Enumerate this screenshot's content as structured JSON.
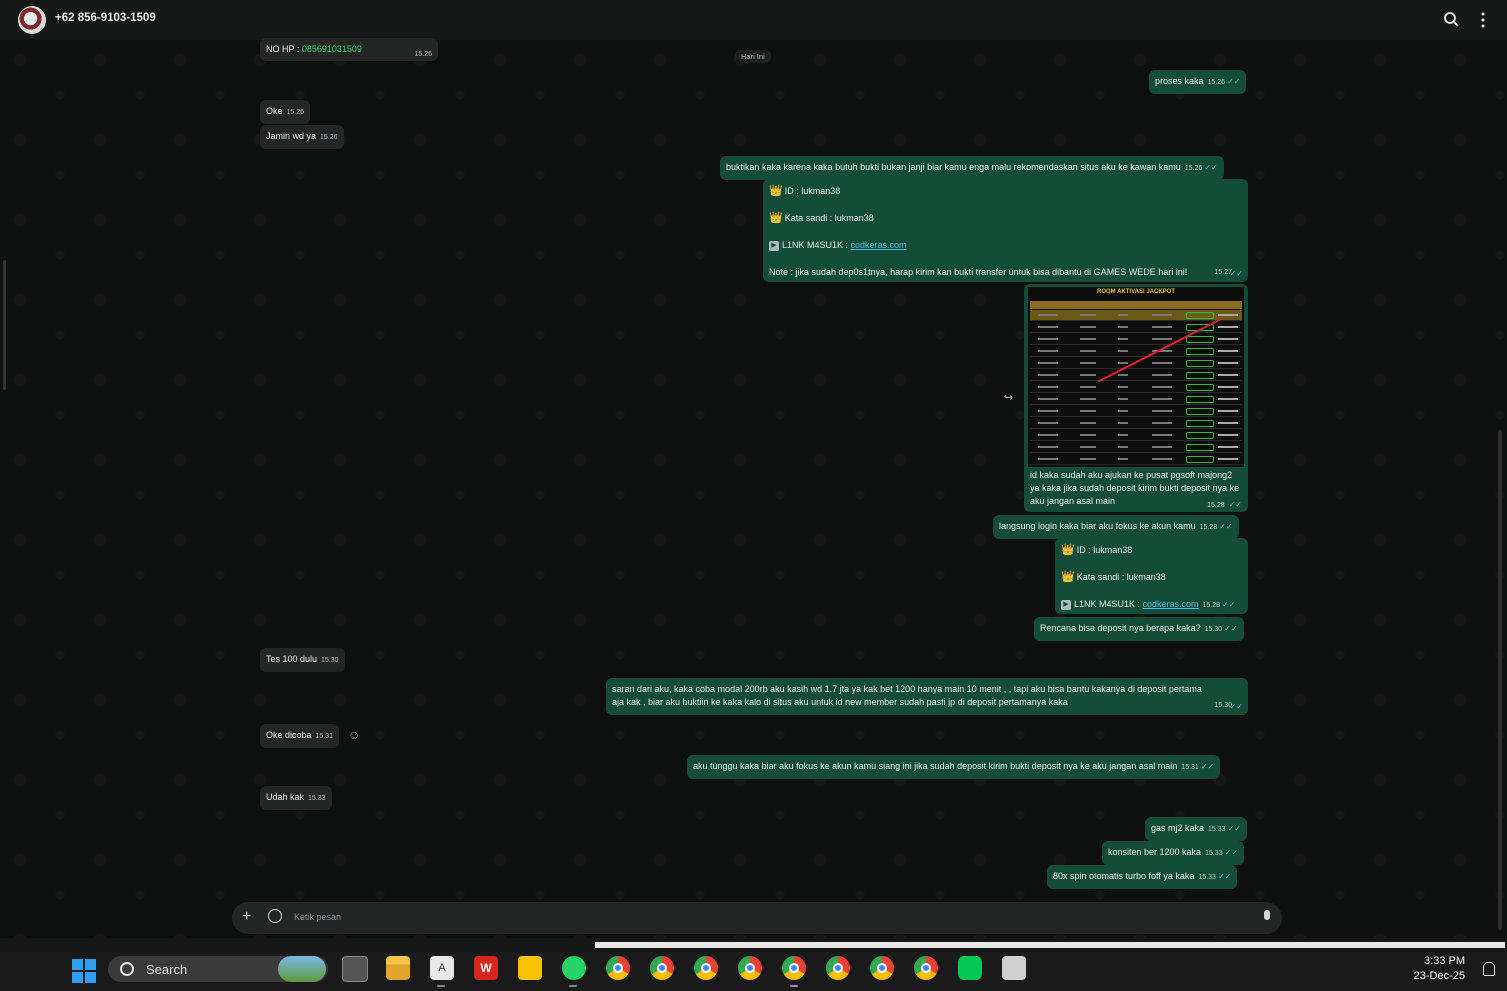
{
  "header": {
    "contact_name": "+62 856-9103-1509",
    "search_icon": "search-icon",
    "menu_icon": "more-vertical-icon"
  },
  "chat": {
    "day_label": "Hari Ini",
    "messages": [
      {
        "dir": "in",
        "text": "NO HP : ",
        "phone": "085691031509",
        "time": "15.26"
      },
      {
        "dir": "out",
        "text": "proses kaka",
        "time": "15.26"
      },
      {
        "dir": "in",
        "text": "Oke",
        "time": "15.26"
      },
      {
        "dir": "in",
        "text": "Jamin wd ya",
        "time": "15.26"
      },
      {
        "dir": "out",
        "text": "buktikan kaka karena kaka butuh bukti bukan janji biar kamu enga malu rekomendaskan situs aku ke kawan kamu",
        "time": "15.26"
      },
      {
        "dir": "out",
        "line1": "ID :  lukman38",
        "line2": "Kata sandi : lukman38",
        "line3": "L1NK M4SU1K : ",
        "link": "codkeras.com",
        "line4": "Note : jika sudah dep0s1tnya, harap kirim kan bukti transfer untuk bisa dibantu di GAMES WEDE hari ini!",
        "time": "15.27"
      },
      {
        "dir": "out",
        "image_title": "ROOM AKTIVASI JACKPOT",
        "caption": "id kaka sudah aku ajukan ke pusat pgsoft majong2 ya kaka jika sudah deposit kirim bukti deposit nya ke aku jangan asal main",
        "time": "15.28"
      },
      {
        "dir": "out",
        "text": "langsung login kaka biar aku fokus ke akun kamu",
        "time": "15.28"
      },
      {
        "dir": "out",
        "line1": "ID :  lukman38",
        "line2": "Kata sandi : lukman38",
        "line3": "L1NK M4SU1K : ",
        "link": "codkeras.com",
        "time": "15.28"
      },
      {
        "dir": "out",
        "text": "Rencana bisa deposit nya berapa kaka?",
        "time": "15.30"
      },
      {
        "dir": "in",
        "text": "Tes 100 dulu",
        "time": "15.30"
      },
      {
        "dir": "out",
        "line1": "saran dari aku, kaka coba modal 200rb aku kasih wd 1.7 jta ya kak bet 1200 hanya main 10 menit , , tapi aku bisa bantu kakanya di deposit pertama",
        "line2": "aja kak , biar aku buktiin ke kaka kalo di situs aku untuk id new member sudah pasti jp di deposit pertamanya kaka",
        "time": "15.30"
      },
      {
        "dir": "in",
        "text": "Oke dicoba",
        "time": "15.31"
      },
      {
        "dir": "out",
        "text": "aku tunggu kaka biar aku fokus ke akun kamu siang ini jika sudah deposit kirim bukti deposit nya ke aku jangan asal main",
        "time": "15.31"
      },
      {
        "dir": "in",
        "text": "Udah kak",
        "time": "15.33"
      },
      {
        "dir": "out",
        "text": "gas mj2 kaka",
        "time": "15.33"
      },
      {
        "dir": "out",
        "text": "konsiten ber 1200 kaka",
        "time": "15.33"
      },
      {
        "dir": "out",
        "text": "80x spin otomatis turbo foff ya kaka",
        "time": "15.33"
      }
    ]
  },
  "composer": {
    "placeholder": "Ketik pesan"
  },
  "taskbar": {
    "search_label": "Search",
    "time": "3:33 PM",
    "date": "23-Dec-25"
  }
}
